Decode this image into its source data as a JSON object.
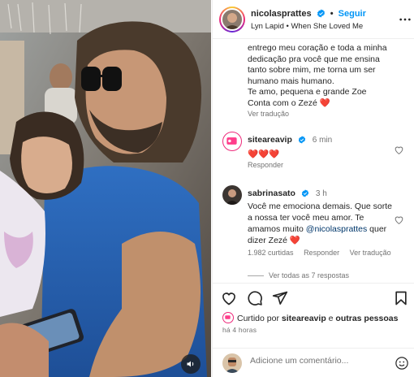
{
  "post": {
    "username": "nicolasprattes",
    "separator": "•",
    "follow_label": "Seguir",
    "audio": "Lyn Lapid • When She Loved Me",
    "caption_lines": [
      "entrego meu coração e toda a minha",
      "dedicação pra você que me ensina",
      "tanto sobre mim, me torna um ser",
      "humano mais humano.",
      "Te amo, pequena e grande Zoe",
      "Conta com o Zezé ❤️"
    ],
    "translate_label": "Ver tradução"
  },
  "comments": [
    {
      "username": "sitearea​vip",
      "time": "6 min",
      "text": "❤️❤️❤️",
      "reply_label": "Responder"
    },
    {
      "username": "sabrinasato",
      "time": "3 h",
      "text_before": "Você me emociona demais. Que sorte a nossa ter você meu amor. Te amamos muito ",
      "mention": "@nicolasprattes",
      "text_after": " quer dizer Zezé ❤️",
      "likes": "1.982 curtidas",
      "reply_label": "Responder",
      "translate_label": "Ver tradução",
      "view_replies": "Ver todas as 7 respostas"
    }
  ],
  "footer": {
    "liked_prefix": "Curtido por ",
    "liked_user": "siteareavip",
    "liked_mid": " e ",
    "liked_others": "outras pessoas",
    "posted_time": "há 4 horas",
    "comment_placeholder": "Adicione um comentário..."
  },
  "icons": {
    "verified": "verified-badge-icon",
    "more": "more-options-icon",
    "heart": "heart-icon",
    "comment": "comment-icon",
    "share": "share-icon",
    "save": "bookmark-icon",
    "emoji": "emoji-icon",
    "mute": "speaker-icon"
  },
  "colors": {
    "accent": "#0095f6",
    "heart": "#ed4956",
    "secondary_text": "#737373",
    "mention": "#00376b"
  }
}
